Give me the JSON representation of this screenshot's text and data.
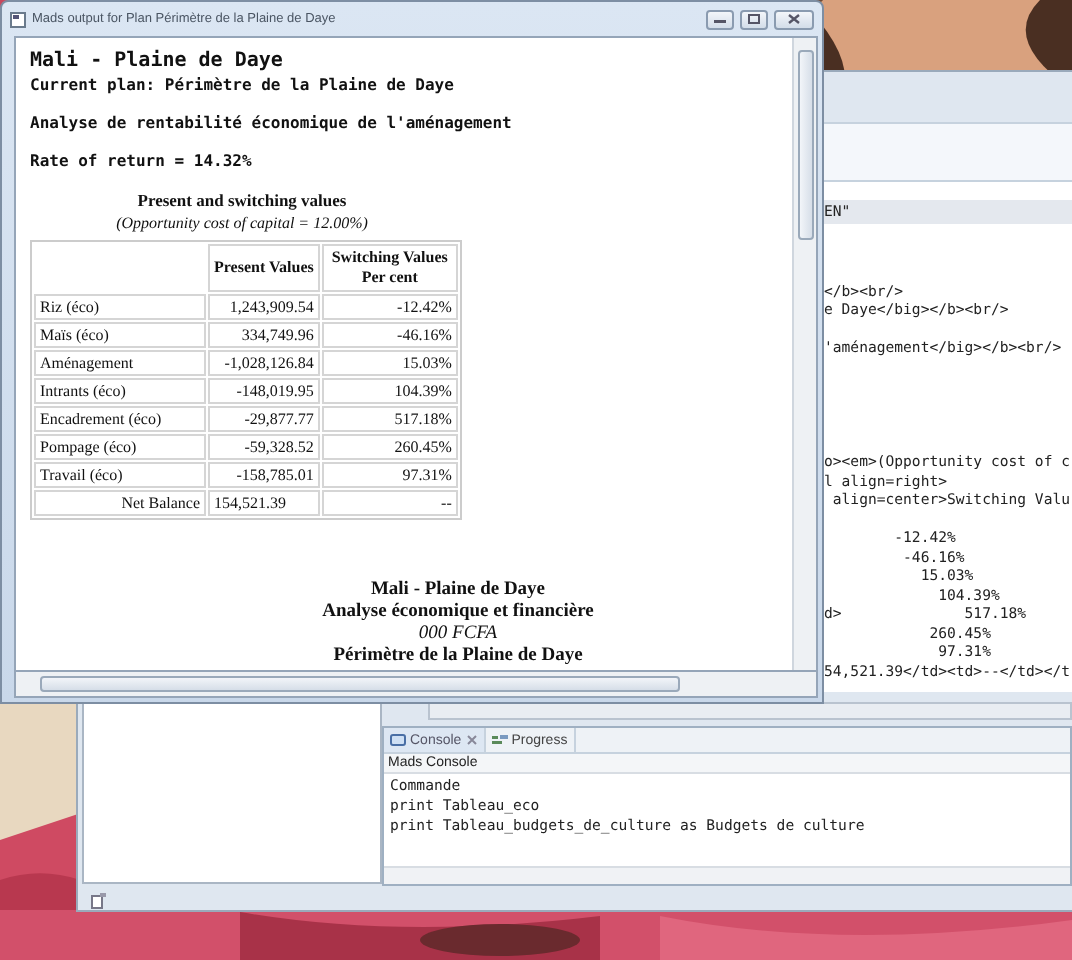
{
  "report_window": {
    "title": "Mads output for Plan Périmètre de la Plaine de Daye",
    "heading": "Mali - Plaine de Daye",
    "current_plan": "Current plan: Périmètre de la Plaine de Daye",
    "analysis": "Analyse de rentabilité économique de l'aménagement",
    "rate": "Rate of return = 14.32%",
    "table_title": "Present and switching values",
    "table_subtitle": "(Opportunity cost of capital = 12.00%)",
    "columns": [
      "Present Values",
      "Switching Values Per cent"
    ],
    "rows": [
      {
        "kind": "item",
        "label": "Riz (éco)",
        "present_value": "1,243,909.54",
        "switching_value": "-12.42%"
      },
      {
        "kind": "item",
        "label": "Maïs (éco)",
        "present_value": "334,749.96",
        "switching_value": "-46.16%"
      },
      {
        "kind": "item",
        "label": "Aménagement",
        "present_value": "-1,028,126.84",
        "switching_value": "15.03%"
      },
      {
        "kind": "item",
        "label": "Intrants (éco)",
        "present_value": "-148,019.95",
        "switching_value": "104.39%"
      },
      {
        "kind": "item",
        "label": "Encadrement (éco)",
        "present_value": "-29,877.77",
        "switching_value": "517.18%"
      },
      {
        "kind": "item",
        "label": "Pompage (éco)",
        "present_value": "-59,328.52",
        "switching_value": "260.45%"
      },
      {
        "kind": "item",
        "label": "Travail (éco)",
        "present_value": "-158,785.01",
        "switching_value": "97.31%"
      },
      {
        "kind": "total",
        "label": "Net Balance",
        "present_value": "154,521.39",
        "switching_value": "--"
      }
    ],
    "footer_lines": [
      {
        "kind": "bold",
        "text": "Mali - Plaine de Daye"
      },
      {
        "kind": "bold",
        "text": "Analyse économique et financière"
      },
      {
        "kind": "italic",
        "text": "000 FCFA"
      },
      {
        "kind": "bold",
        "text": "Périmètre de la Plaine de Daye"
      }
    ]
  },
  "editor": {
    "lines": [
      "EN\"",
      "</b><br/>",
      "e Daye</big></b><br/>",
      "'aménagement</big></b><br/>",
      "o><em>(Opportunity cost of c",
      "l align=right>",
      " align=center>Switching Valu",
      "        -12.42%",
      "         -46.16%",
      "           15.03%",
      "             104.39%",
      "d>              517.18%",
      "            260.45%",
      "             97.31%",
      "54,521.39</td><td>--</td></t"
    ]
  },
  "console": {
    "tabs": [
      {
        "label": "Console",
        "selected": true
      },
      {
        "label": "Progress",
        "selected": false
      }
    ],
    "name": "Mads Console",
    "lines": [
      "Commande",
      "print Tableau_eco",
      "print Tableau_budgets_de_culture as Budgets de culture"
    ]
  }
}
